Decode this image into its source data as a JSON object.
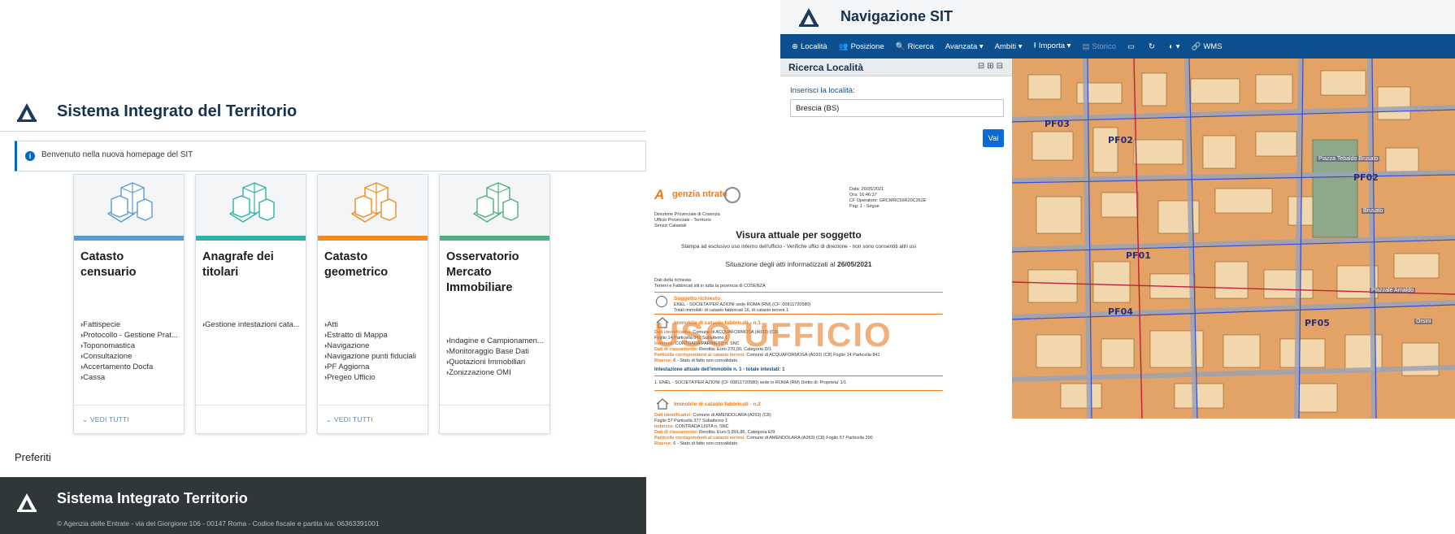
{
  "sit_home": {
    "title": "Sistema Integrato del Territorio",
    "info": "Benvenuto nella nuova homepage del SIT",
    "cards": [
      {
        "title": "Catasto censuario",
        "color": "#5b9bd5",
        "links": [
          "Fattispecie",
          "Protocollo - Gestione Prat...",
          "Toponomastica",
          "Consultazione",
          "Accertamento Docfa",
          "Cassa"
        ],
        "more": "VEDI TUTTI"
      },
      {
        "title": "Anagrafe dei titolari",
        "color": "#2bb3a6",
        "links": [
          "Gestione intestazioni cata..."
        ],
        "more": ""
      },
      {
        "title": "Catasto geometrico",
        "color": "#f28a1e",
        "links": [
          "Atti",
          "Estratto di Mappa",
          "Navigazione",
          "Navigazione punti fiduciali",
          "PF Aggiorna",
          "Pregeo Ufficio"
        ],
        "more": "VEDI TUTTI"
      },
      {
        "title": "Osservatorio Mercato Immobiliare",
        "color": "#4caf7d",
        "links": [
          "Indagine e Campionamen...",
          "Monitoraggio Base Dati",
          "Quotazioni Immobiliari",
          "Zonizzazione OMI"
        ],
        "more": ""
      }
    ],
    "preferiti": "Preferiti",
    "footer_title": "Sistema Integrato Territorio",
    "footer_copy": "© Agenzia delle Entrate - via del Giorgione 106 - 00147 Roma - Codice fiscale e partita iva: 06363391001"
  },
  "nav_sit": {
    "title": "Navigazione SIT",
    "menu": [
      {
        "icon": "globe-icon",
        "glyph": "⊕",
        "label": "Località"
      },
      {
        "icon": "people-icon",
        "glyph": "👥",
        "label": "Posizione"
      },
      {
        "icon": "search-icon",
        "glyph": "🔍",
        "label": "Ricerca"
      },
      {
        "icon": "",
        "glyph": "",
        "label": "Avanzata ▾"
      },
      {
        "icon": "",
        "glyph": "",
        "label": "Ambiti ▾"
      },
      {
        "icon": "upload-icon",
        "glyph": "⭱",
        "label": "Importa ▾"
      },
      {
        "icon": "history-icon",
        "glyph": "▤",
        "label": "Storico"
      },
      {
        "icon": "monitor-icon",
        "glyph": "▭",
        "label": ""
      },
      {
        "icon": "refresh-icon",
        "glyph": "↻",
        "label": ""
      },
      {
        "icon": "contrast-icon",
        "glyph": "◐",
        "label": "▾"
      },
      {
        "icon": "link-icon",
        "glyph": "🔗",
        "label": "WMS"
      }
    ],
    "panel_title": "Ricerca Località",
    "panel_label": "Inserisci la località:",
    "search_value": "Brescia (BS)",
    "vai": "Vai",
    "map_labels": [
      "PF03",
      "PF02",
      "PF01",
      "PF02",
      "PF04",
      "PF05"
    ],
    "map_streets": [
      "Piazzale Arnaldo",
      "Piazza Tebaldo Brusato",
      "Brusato",
      "Orsini"
    ]
  },
  "visura": {
    "agency_lettering": "genzia ntrate",
    "direzione": [
      "Direzione Provinciale di Cosenza",
      "Ufficio Provinciale - Territorio",
      "Servizi Catastali"
    ],
    "meta": [
      "Data: 26/05/2021",
      "Ora: 16:46:37",
      "CF Operatore: GRCMRC56R20C352E",
      "Pag: 1 - Segue"
    ],
    "title": "Visura attuale per soggetto",
    "sub": "Stampa ad esclusivo uso interno dell'ufficio - Verifiche uffici di direzione - non sono consentiti altri usi",
    "situazione_prefix": "Situazione degli atti informatizzati al ",
    "situazione_date": "26/05/2021",
    "dati": [
      "Dati della richiesta",
      "Terreni e Fabbricati siti in tutta la provincia di COSENZA"
    ],
    "soggetto_label": "Soggetto richiesto:",
    "soggetto_lines": [
      "ENEL - SOCIETA'PER AZIONI sede ROMA (RM) (CF: 00811720580)",
      "Totali immobili: di catasto fabbricati 16, di catasto terreni 1"
    ],
    "immobile1": "Immobile di catasto fabbricati - n.1",
    "immobile1_lines": [
      {
        "k": "Dati identificativi:",
        "v": " Comune di ACQUAFORMOSA (A033) (C8)"
      },
      {
        "k": "",
        "v": "Foglio 14 Particella 841 Subalterno 1"
      },
      {
        "k": "Indirizzo:",
        "v": " CONTRADA PARNIETO n. SNC"
      },
      {
        "k": "Dati di classamento:",
        "v": " Rendita: Euro 270,00, Categoria D/1"
      },
      {
        "k": "Particelle corrispondenti al catasto terreni:",
        "v": " Comune di ACQUAFORMOSA (A033) (C8) Foglio 14 Particella 841"
      },
      {
        "k": "Riserve:",
        "v": " 6 - Stato di fatto non convalidato"
      }
    ],
    "stamp": "USO UFFICIO",
    "intestazione": "Intestazione attuale dell'immobile n. 1 - totale intestati: 1",
    "intestatario": "1. ENEL - SOCIETA'PER AZIONI (CF 00811720580) sede in ROMA (RM) Diritto di: Proprieta' 1/1",
    "immobile2": "Immobile di catasto fabbricati - n.2",
    "immobile2_lines": [
      {
        "k": "Dati identificativi:",
        "v": " Comune di AMENDOLARA (A263) (C8)"
      },
      {
        "k": "",
        "v": "Foglio 57 Particella 377 Subalterno 1"
      },
      {
        "k": "Indirizzo:",
        "v": " CONTRADA LISTA n. SNC"
      },
      {
        "k": "Dati di classamento:",
        "v": " Rendita: Euro 5.891,86, Categoria E/9"
      },
      {
        "k": "Particelle corrispondenti al catasto terreni:",
        "v": " Comune di AMENDOLARA (A263) (C8) Foglio 57 Particella 290"
      },
      {
        "k": "Riserve:",
        "v": " 6 - Stato di fatto non convalidato"
      }
    ]
  }
}
